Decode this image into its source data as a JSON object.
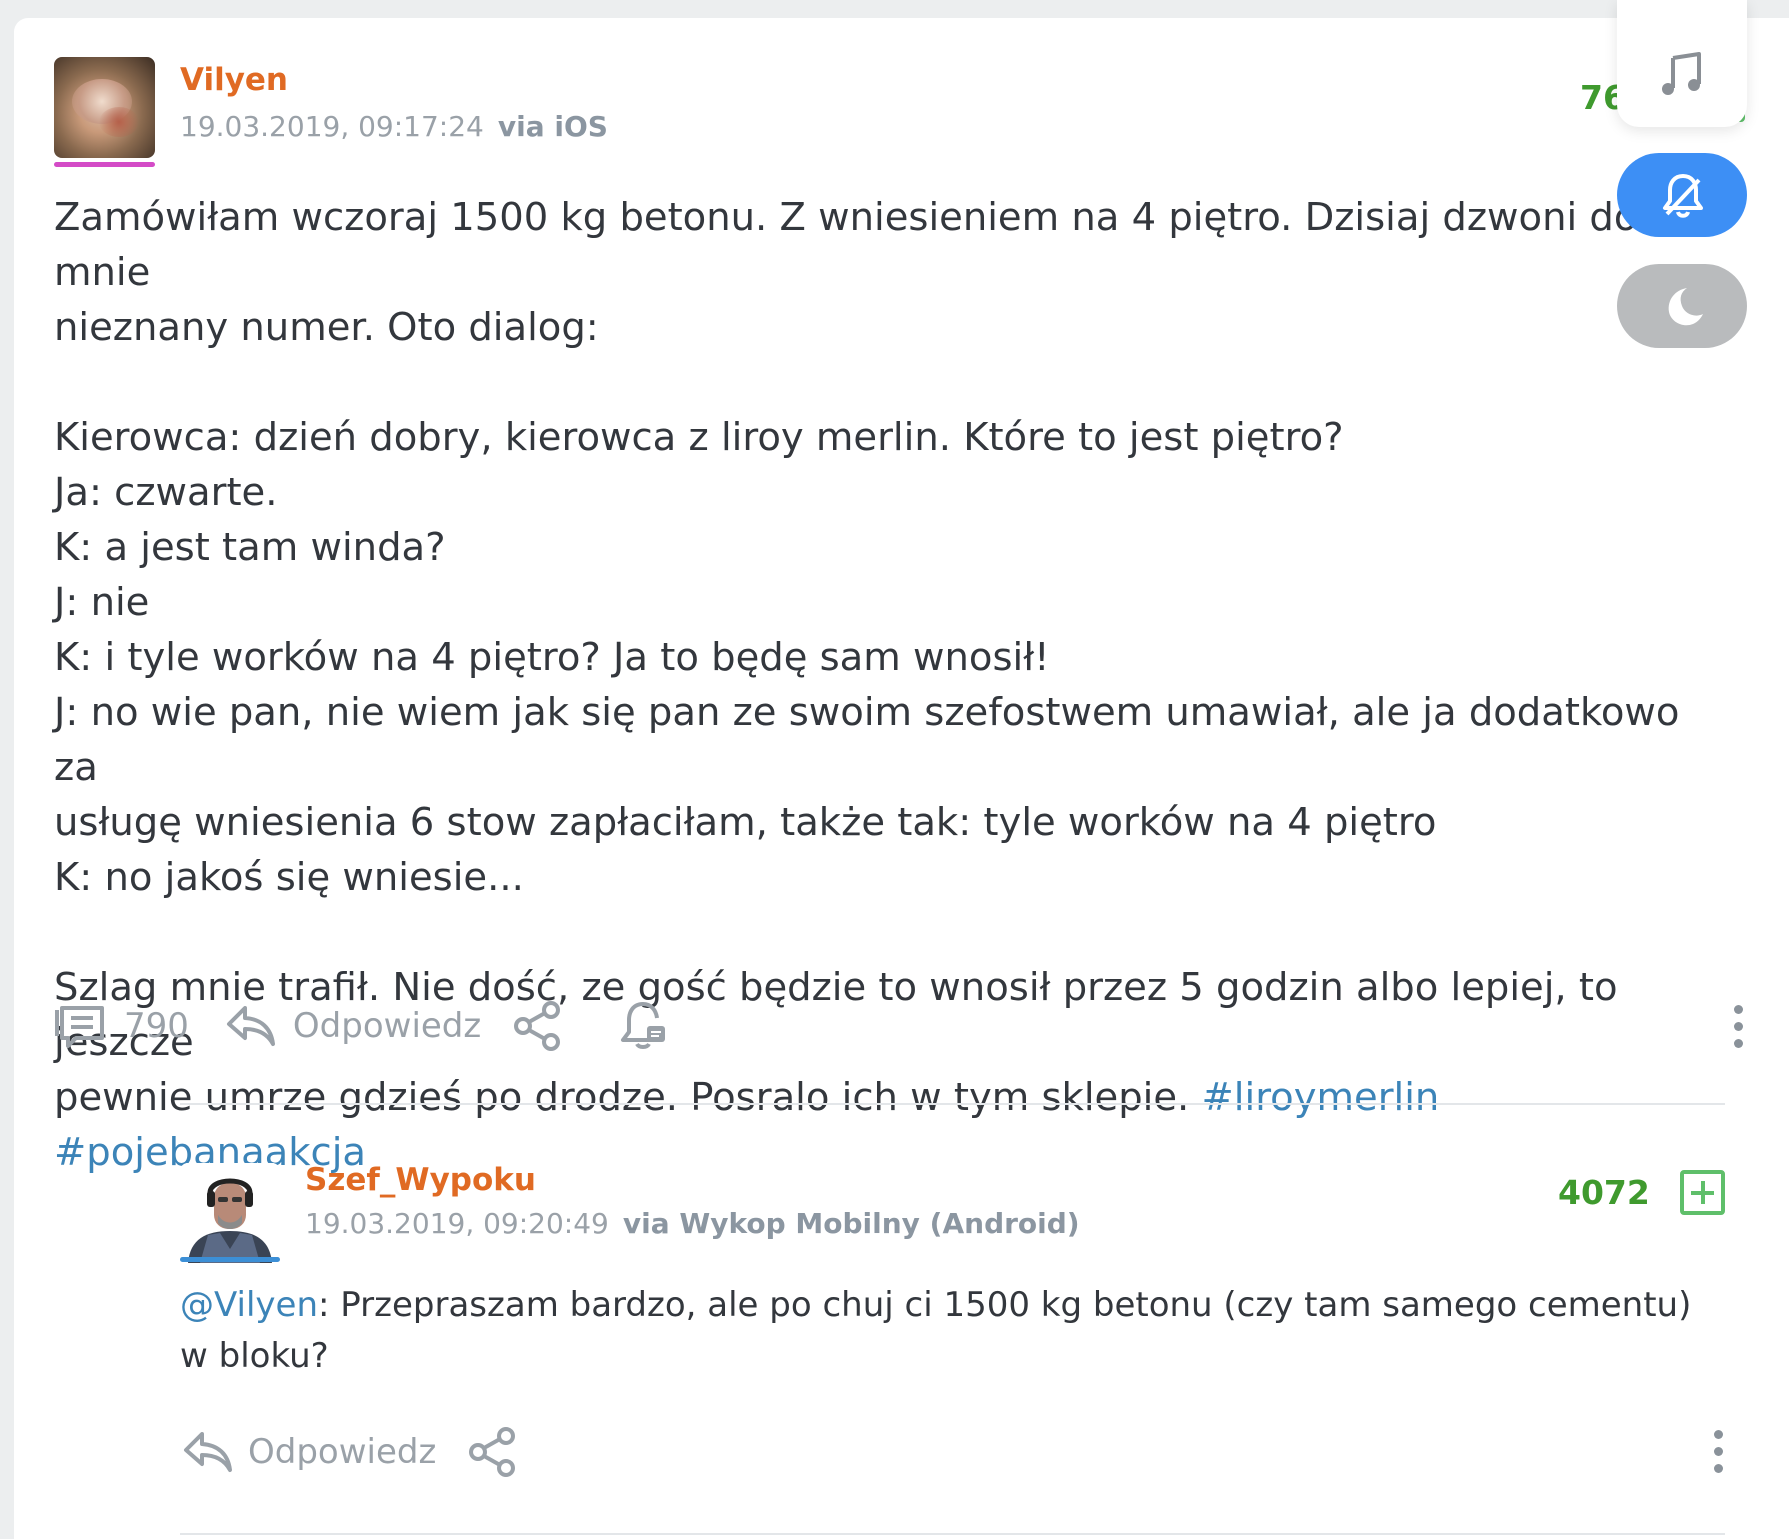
{
  "entry": {
    "author": "Vilyen",
    "date": "19.03.2019, 09:17:24",
    "via": "via iOS",
    "votes": "76",
    "body_paragraphs": [
      "Zamówiłam wczoraj 1500 kg betonu. Z wniesieniem na 4 piętro. Dzisiaj dzwoni do mnie\nnieznany numer. Oto dialog:",
      "Kierowca: dzień dobry, kierowca z liroy merlin. Które to jest piętro?\nJa: czwarte.\nK: a jest tam winda?\nJ: nie\nK: i tyle worków na 4 piętro? Ja to będę sam wnosił!\nJ: no wie pan, nie wiem jak się pan ze swoim szefostwem umawiał, ale ja dodatkowo za\nusługę wniesienia 6 stow zapłaciłam, także tak: tyle worków na 4 piętro\nK: no jakoś się wniesie...",
      "Szlag mnie trafił. Nie dość, ze gość będzie to wnosił przez 5 godzin albo lepiej, to jeszcze\npewnie umrze gdzieś po drodze. Posralo ich w tym sklepie. "
    ],
    "tags": [
      "#liroymerlin",
      "#pojebanaakcja"
    ],
    "comments_count": "790",
    "reply_label": "Odpowiedz"
  },
  "reply": {
    "author": "Szef_Wypoku",
    "date": "19.03.2019, 09:20:49",
    "via": "via Wykop Mobilny (Android)",
    "votes": "4072",
    "mention": "@Vilyen",
    "text": ": Przepraszam bardzo, ale po chuj ci 1500 kg betonu (czy tam samego cementu) w bloku?",
    "reply_label": "Odpowiedz"
  },
  "colors": {
    "author": "#e06a23",
    "votes": "#3f9a2e",
    "tag": "#3c84b8",
    "fab_blue": "#3d8ff5",
    "fab_gray": "#b9bbbd"
  },
  "icons": [
    "comments-icon",
    "reply-icon",
    "share-icon",
    "bell-icon",
    "more-icon",
    "music-icon",
    "bell-off-icon",
    "moon-icon"
  ]
}
